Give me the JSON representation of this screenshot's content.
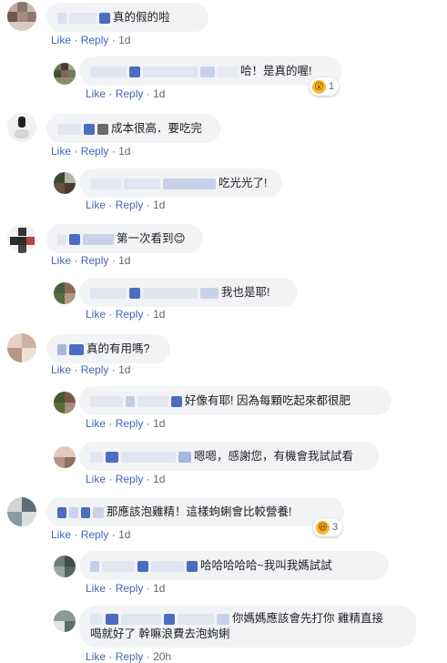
{
  "actions": {
    "like": "Like",
    "dot": "·",
    "reply": "Reply"
  },
  "comments": [
    {
      "text": "真的假的啦",
      "time": "1d"
    },
    {
      "text": "哈！是真的喔!",
      "time": "1d",
      "reaction_icon": "wow-emoji-icon",
      "reaction_glyph": "😮",
      "reaction_count": "1"
    },
    {
      "text": "成本很高．要吃完",
      "time": "1d"
    },
    {
      "text": "吃光光了!",
      "time": "1d"
    },
    {
      "text": "第一次看到😊",
      "time": "1d"
    },
    {
      "text": "我也是耶!",
      "time": "1d"
    },
    {
      "text": "真的有用嗎?",
      "time": "1d"
    },
    {
      "text": "好像有耶! 因為每顆吃起來都很肥",
      "time": "1d"
    },
    {
      "text": "嗯嗯，感謝您，有機會我試試看",
      "time": "1d"
    },
    {
      "text": "那應該泡雞精！這樣蚼蜊會比較營養!",
      "time": "1d",
      "reaction_icon": "haha-emoji-icon",
      "reaction_glyph": "😆",
      "reaction_count": "3"
    },
    {
      "text": "哈哈哈哈哈~我叫我媽試試",
      "time": "1d"
    },
    {
      "text_line1": "你媽媽應該會先打你 雞精直接",
      "text_line2": "喝就好了 幹嘛浪費去泡蚼蜊",
      "time": "20h"
    }
  ]
}
